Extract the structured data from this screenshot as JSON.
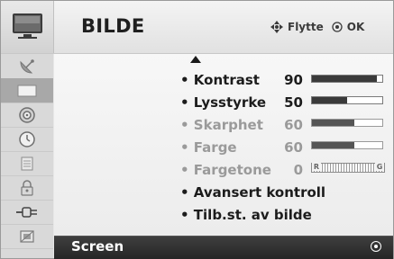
{
  "menu": {
    "title": "BILDE",
    "hint_move": "Flytte",
    "hint_ok": "OK"
  },
  "side_icons": [
    {
      "name": "tv-icon"
    },
    {
      "name": "satellite-dish-icon"
    },
    {
      "name": "picture-icon"
    },
    {
      "name": "audio-icon"
    },
    {
      "name": "clock-icon"
    },
    {
      "name": "option-icon"
    },
    {
      "name": "lock-icon"
    },
    {
      "name": "input-icon"
    },
    {
      "name": "usb-icon"
    }
  ],
  "items": [
    {
      "label": "• Kontrast",
      "value": "90",
      "level": 0.92,
      "enabled": true
    },
    {
      "label": "• Lysstyrke",
      "value": "50",
      "level": 0.5,
      "enabled": true
    },
    {
      "label": "• Skarphet",
      "value": "60",
      "level": 0.6,
      "enabled": false
    },
    {
      "label": "• Farge",
      "value": "60",
      "level": 0.6,
      "enabled": false
    },
    {
      "label": "• Fargetone",
      "value": "0",
      "enabled": false,
      "tint_left": "R",
      "tint_right": "G"
    },
    {
      "label": "• Avansert kontroll",
      "enabled": true
    },
    {
      "label": "• Tilb.st. av bilde",
      "enabled": true
    }
  ],
  "selected": {
    "label": "Screen"
  }
}
